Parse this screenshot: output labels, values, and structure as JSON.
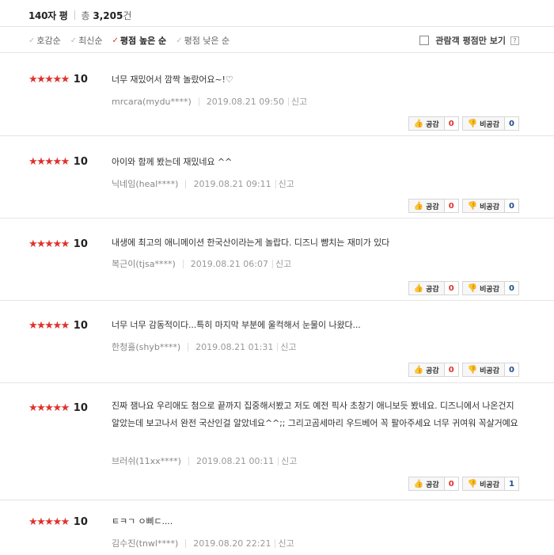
{
  "header": {
    "title": "140자 평",
    "total_prefix": "총",
    "total_count": "3,205",
    "total_suffix": "건"
  },
  "sort_options": [
    {
      "label": "호감순",
      "active": false
    },
    {
      "label": "최신순",
      "active": false
    },
    {
      "label": "평점 높은 순",
      "active": true
    },
    {
      "label": "평점 낮은 순",
      "active": false
    }
  ],
  "viewer_only_label": "관람객 평점만 보기",
  "viewer_help": "?",
  "report_label": "신고",
  "like_label": "공감",
  "dislike_label": "비공감",
  "stars": "★★★★★",
  "accent_color": "#e0312b",
  "reviews": [
    {
      "score": "10",
      "text": "너무 재밌어서 깜짝 놀랐어요~!♡",
      "user": "mrcara(mydu****)",
      "date": "2019.08.21 09:50",
      "likes": "0",
      "dislikes": "0"
    },
    {
      "score": "10",
      "text": "아이와 함께 봤는데 재밌네요 ^^",
      "user": "닉네임(heal****)",
      "date": "2019.08.21 09:11",
      "likes": "0",
      "dislikes": "0"
    },
    {
      "score": "10",
      "text": "내생에 최고의 애니메이션 한국산이라는게 놀랍다. 디즈니 뺨치는 재미가 있다",
      "user": "복근이(tjsa****)",
      "date": "2019.08.21 06:07",
      "likes": "0",
      "dislikes": "0"
    },
    {
      "score": "10",
      "text": "너무 너무 감동적이다...특히 마지막 부분에 울컥해서 눈물이 나왔다...",
      "user": "한청흘(shyb****)",
      "date": "2019.08.21 01:31",
      "likes": "0",
      "dislikes": "0"
    },
    {
      "score": "10",
      "text": "진짜 잼나요 우리애도 첨으로 끝까지 집중해서봤고 저도 예전 픽사 초창기 애니보듯 봤네요. 디즈니에서 나온건지 알았는데 보고나서 완전 국산인걸 알았네요^^;; 그리고곰세마리 우드베어 꼭 팔아주세요 너무 귀여워 꼭살거예요",
      "user": "브러쉬(11xx****)",
      "date": "2019.08.21 00:11",
      "likes": "0",
      "dislikes": "1"
    },
    {
      "score": "10",
      "text": "ㅌㅋㄱ ㅇ삐ㄷ....",
      "user": "김수진(tnwl****)",
      "date": "2019.08.20 22:21",
      "likes": null,
      "dislikes": null
    }
  ]
}
